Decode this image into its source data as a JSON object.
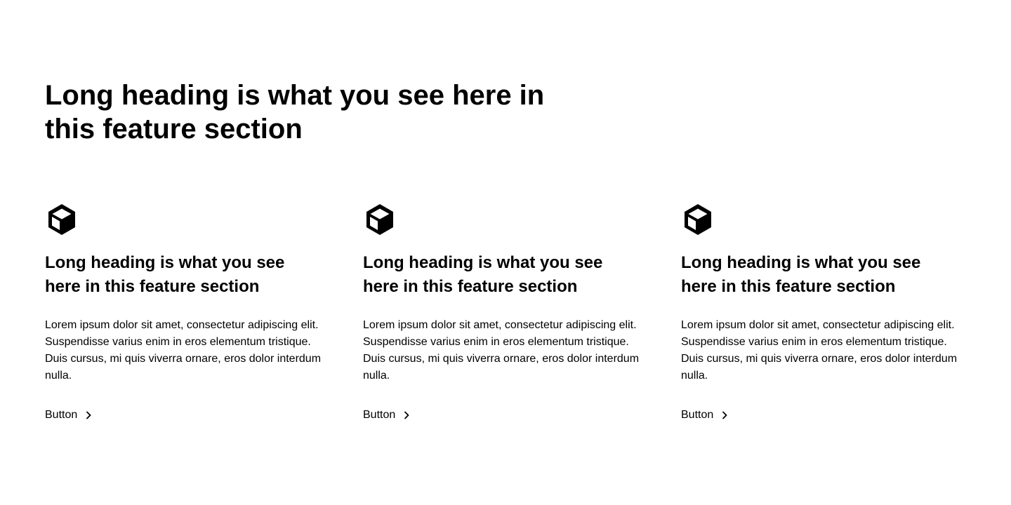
{
  "main_heading": "Long heading is what you see here in this feature section",
  "features": [
    {
      "icon": "cube-icon",
      "heading": "Long heading is what you see here in this feature section",
      "text": "Lorem ipsum dolor sit amet, consectetur adipiscing elit. Suspendisse varius enim in eros elementum tristique. Duis cursus, mi quis viverra ornare, eros dolor interdum nulla.",
      "button_label": "Button",
      "button_icon": "chevron-right-icon"
    },
    {
      "icon": "cube-icon",
      "heading": "Long heading is what you see here in this feature section",
      "text": "Lorem ipsum dolor sit amet, consectetur adipiscing elit. Suspendisse varius enim in eros elementum tristique. Duis cursus, mi quis viverra ornare, eros dolor interdum nulla.",
      "button_label": "Button",
      "button_icon": "chevron-right-icon"
    },
    {
      "icon": "cube-icon",
      "heading": "Long heading is what you see here in this feature section",
      "text": "Lorem ipsum dolor sit amet, consectetur adipiscing elit. Suspendisse varius enim in eros elementum tristique. Duis cursus, mi quis viverra ornare, eros dolor interdum nulla.",
      "button_label": "Button",
      "button_icon": "chevron-right-icon"
    }
  ],
  "colors": {
    "background": "#ffffff",
    "text": "#000000"
  }
}
